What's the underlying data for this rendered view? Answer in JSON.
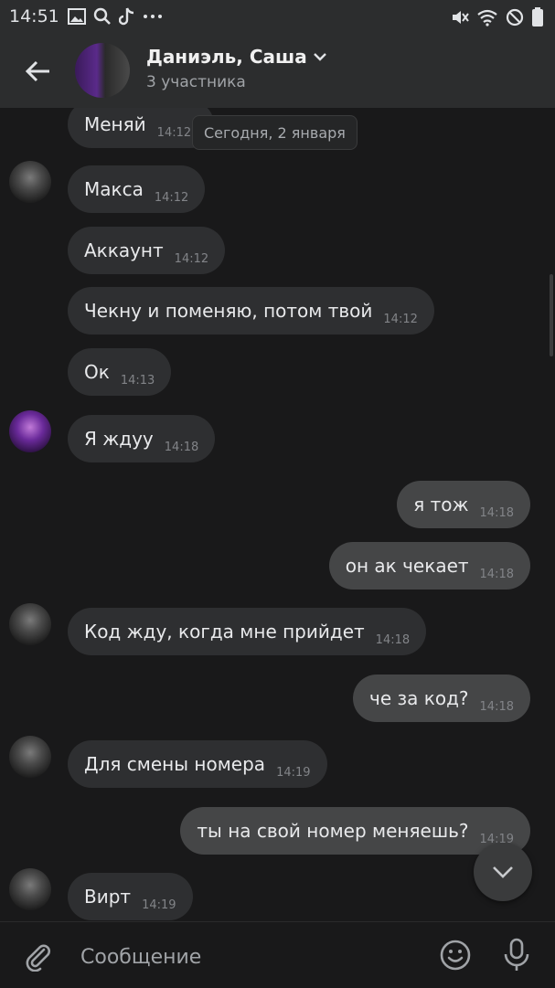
{
  "status_bar": {
    "time": "14:51"
  },
  "header": {
    "title": "Даниэль, Саша",
    "subtitle": "3 участника"
  },
  "date_chip": "Сегодня, 2 января",
  "messages": [
    {
      "text": "Меняй",
      "time": "14:12"
    },
    {
      "text": "Макса",
      "time": "14:12"
    },
    {
      "text": "Аккаунт",
      "time": "14:12"
    },
    {
      "text": "Чекну и поменяю, потом твой",
      "time": "14:12"
    },
    {
      "text": "Ок",
      "time": "14:13"
    },
    {
      "text": "Я ждуу",
      "time": "14:18"
    },
    {
      "text": "я тож",
      "time": "14:18"
    },
    {
      "text": "он ак чекает",
      "time": "14:18"
    },
    {
      "text": "Код жду, когда мне прийдет",
      "time": "14:18"
    },
    {
      "text": "че за код?",
      "time": "14:18"
    },
    {
      "text": "Для смены номера",
      "time": "14:19"
    },
    {
      "text": "ты на свой номер меняешь?",
      "time": "14:19"
    },
    {
      "text": "Вирт",
      "time": "14:19"
    }
  ],
  "composer": {
    "placeholder": "Сообщение"
  },
  "colors": {
    "background": "#19191a",
    "header": "#2c2d2e",
    "bubble_in": "#2e2f31",
    "bubble_out": "#454647"
  }
}
